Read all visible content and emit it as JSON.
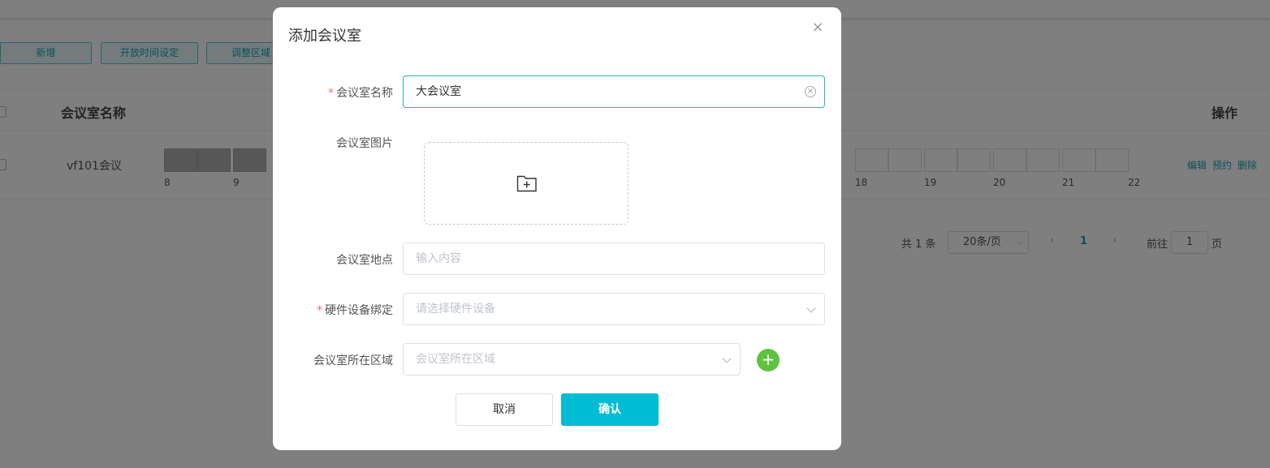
{
  "background": {
    "toolbar": [
      "新增",
      "开放时间设定",
      "调整区域"
    ],
    "table": {
      "col_name": "会议室名称",
      "col_ops": "操作",
      "row": {
        "name": "vf101会议",
        "hours": [
          "8",
          "9",
          "18",
          "19",
          "20",
          "21",
          "22"
        ],
        "ops": [
          "编辑",
          "预约",
          "删除"
        ]
      }
    },
    "pager": {
      "total": "共 1 条",
      "page_size": "20条/页",
      "prev": "‹",
      "current": "1",
      "next": "›",
      "goto_label": "前往",
      "goto_value": "1",
      "page_label": "页"
    }
  },
  "dialog": {
    "title": "添加会议室",
    "close": "×",
    "required_mark": "*",
    "fields": {
      "name": {
        "label": "会议室名称",
        "value": "大会议室"
      },
      "image": {
        "label": "会议室图片"
      },
      "location": {
        "label": "会议室地点",
        "placeholder": "输入内容"
      },
      "hardware": {
        "label": "硬件设备绑定",
        "placeholder": "请选择硬件设备"
      },
      "area": {
        "label": "会议室所在区域",
        "placeholder": "会议室所在区域"
      }
    },
    "add_area": "+",
    "cancel": "取消",
    "confirm": "确认"
  },
  "colors": {
    "accent": "#00bcd4",
    "required": "#f56c6c",
    "add_green": "#5fc33f"
  },
  "icons": {
    "close": "close-icon",
    "clear": "clear-circle-icon",
    "dropdown": "chevron-down-icon",
    "upload": "folder-plus-icon"
  }
}
